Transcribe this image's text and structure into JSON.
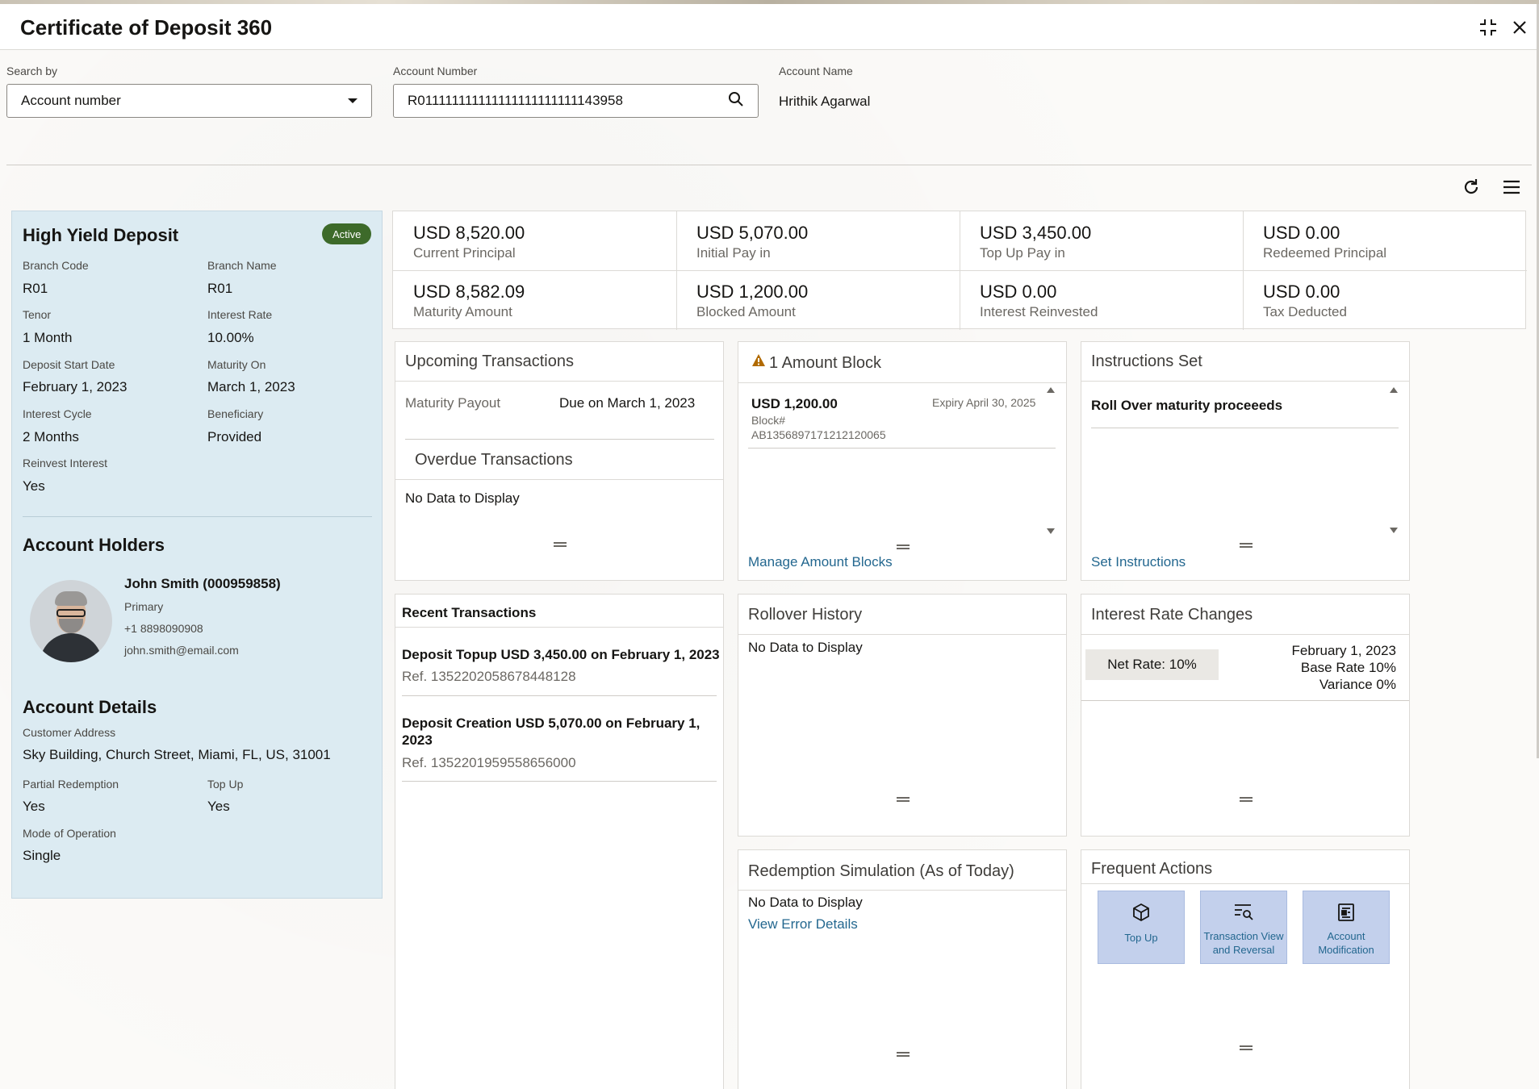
{
  "window": {
    "title": "Certificate of Deposit 360"
  },
  "search": {
    "search_by_label": "Search by",
    "search_by_value": "Account number",
    "account_number_label": "Account Number",
    "account_number_value": "R011111111111111111111111143958",
    "account_name_label": "Account Name",
    "account_name_value": "Hrithik Agarwal"
  },
  "deposit": {
    "name": "High Yield Deposit",
    "status": "Active",
    "fields": [
      {
        "label": "Branch Code",
        "value": "R01"
      },
      {
        "label": "Branch Name",
        "value": "R01"
      },
      {
        "label": "Tenor",
        "value": "1 Month"
      },
      {
        "label": "Interest Rate",
        "value": "10.00%"
      },
      {
        "label": "Deposit Start Date",
        "value": "February 1, 2023"
      },
      {
        "label": "Maturity On",
        "value": "March 1, 2023"
      },
      {
        "label": "Interest Cycle",
        "value": "2 Months"
      },
      {
        "label": "Beneficiary",
        "value": "Provided"
      },
      {
        "label": "Reinvest Interest",
        "value": "Yes"
      }
    ]
  },
  "holders": {
    "title": "Account Holders",
    "name": "John Smith (000959858)",
    "role": "Primary",
    "phone": "+1 8898090908",
    "email": "john.smith@email.com"
  },
  "account_details": {
    "title": "Account Details",
    "address_label": "Customer Address",
    "address_value": "Sky Building, Church Street, Miami, FL, US, 31001",
    "partial_label": "Partial Redemption",
    "partial_value": "Yes",
    "topup_label": "Top Up",
    "topup_value": "Yes",
    "mode_label": "Mode of Operation",
    "mode_value": "Single"
  },
  "summary": [
    {
      "amount": "USD 8,520.00",
      "caption": "Current Principal"
    },
    {
      "amount": "USD 5,070.00",
      "caption": "Initial Pay in"
    },
    {
      "amount": "USD 3,450.00",
      "caption": "Top Up Pay in"
    },
    {
      "amount": "USD 0.00",
      "caption": "Redeemed Principal"
    },
    {
      "amount": "USD 8,582.09",
      "caption": "Maturity Amount"
    },
    {
      "amount": "USD 1,200.00",
      "caption": "Blocked Amount"
    },
    {
      "amount": "USD 0.00",
      "caption": "Interest Reinvested"
    },
    {
      "amount": "USD 0.00",
      "caption": "Tax Deducted"
    }
  ],
  "upcoming": {
    "title": "Upcoming Transactions",
    "item_label": "Maturity Payout",
    "item_value": "Due on March 1, 2023",
    "overdue_title": "Overdue Transactions",
    "overdue_empty": "No Data to Display"
  },
  "amount_block": {
    "title": "1 Amount Block",
    "amount": "USD 1,200.00",
    "expiry": "Expiry April 30, 2025",
    "block_label": "Block#",
    "block_id": "AB1356897171212120065",
    "manage_link": "Manage Amount Blocks"
  },
  "instructions": {
    "title": "Instructions Set",
    "item": "Roll Over maturity proceeeds",
    "link": "Set Instructions"
  },
  "recent": {
    "title": "Recent Transactions",
    "items": [
      {
        "desc": "Deposit Topup USD 3,450.00 on February 1, 2023",
        "ref": "Ref. 1352202058678448128"
      },
      {
        "desc_line1": "Deposit Creation USD 5,070.00 on February 1,",
        "desc_line2": "2023",
        "ref": "Ref. 1352201959558656000"
      }
    ]
  },
  "rollover": {
    "title": "Rollover History",
    "empty": "No Data to Display"
  },
  "interest_changes": {
    "title": "Interest Rate Changes",
    "net_rate": "Net Rate: 10%",
    "date": "February 1, 2023",
    "base_rate": "Base Rate 10%",
    "variance": "Variance 0%"
  },
  "redemption": {
    "title": "Redemption Simulation (As of Today)",
    "empty": "No Data to Display",
    "error_link": "View Error Details"
  },
  "frequent": {
    "title": "Frequent Actions",
    "actions": [
      {
        "label_line1": "Top Up",
        "label_line2": "",
        "icon": "cube-icon"
      },
      {
        "label_line1": "Transaction View",
        "label_line2": "and Reversal",
        "icon": "list-search-icon"
      },
      {
        "label_line1": "Account",
        "label_line2": "Modification",
        "icon": "document-edit-icon"
      }
    ]
  },
  "colors": {
    "active_badge": "#3d6a2a",
    "link": "#23678f",
    "left_panel": "#dcebf2",
    "action_tile": "#c3d0ec",
    "warning": "#b16a00"
  }
}
